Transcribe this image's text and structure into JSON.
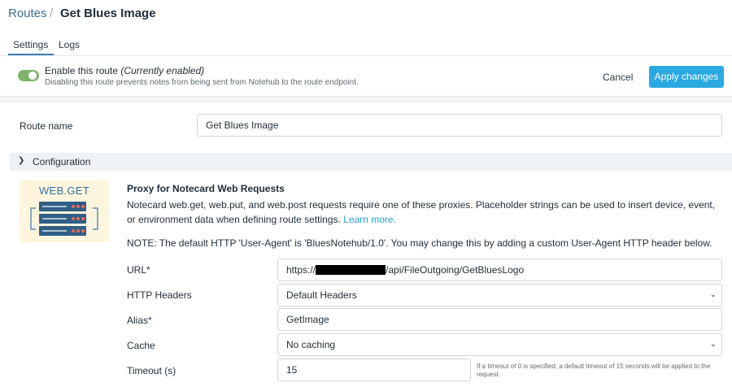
{
  "breadcrumb": {
    "root": "Routes",
    "separator": "/",
    "current": "Get Blues Image"
  },
  "tabs": [
    {
      "label": "Settings",
      "active": true
    },
    {
      "label": "Logs",
      "active": false
    }
  ],
  "enable": {
    "label": "Enable this route",
    "state": "(Currently enabled)",
    "description": "Disabling this route prevents notes from being sent from Notehub to the route endpoint.",
    "on": true
  },
  "actions": {
    "cancel": "Cancel",
    "apply": "Apply changes"
  },
  "route_name": {
    "label": "Route name",
    "value": "Get Blues Image"
  },
  "configuration": {
    "title": "Configuration",
    "logo_text": "WEB.GET",
    "proxy_title": "Proxy for Notecard Web Requests",
    "proxy_desc": "Notecard web.get, web.put, and web.post requests require one of these proxies. Placeholder strings can be used to insert device, event, or environment data when defining route settings.",
    "learn_more": "Learn more.",
    "note": "NOTE: The default HTTP 'User-Agent' is 'BluesNotehub/1.0'. You may change this by adding a custom User-Agent HTTP header below."
  },
  "form": {
    "url": {
      "label": "URL*",
      "prefix": "https://",
      "suffix": "/api/FileOutgoing/GetBluesLogo"
    },
    "headers": {
      "label": "HTTP Headers",
      "value": "Default Headers"
    },
    "alias": {
      "label": "Alias*",
      "value": "GetImage"
    },
    "cache": {
      "label": "Cache",
      "value": "No caching"
    },
    "timeout": {
      "label": "Timeout (s)",
      "value": "15",
      "help": "If a timeout of 0 is specified, a default timeout of 15 seconds will be applied to the request."
    }
  },
  "colors": {
    "accent": "#2aa9e0",
    "toggle_on": "#7fb56a",
    "link": "#2aa0d6",
    "breadcrumb": "#3d6f96"
  }
}
